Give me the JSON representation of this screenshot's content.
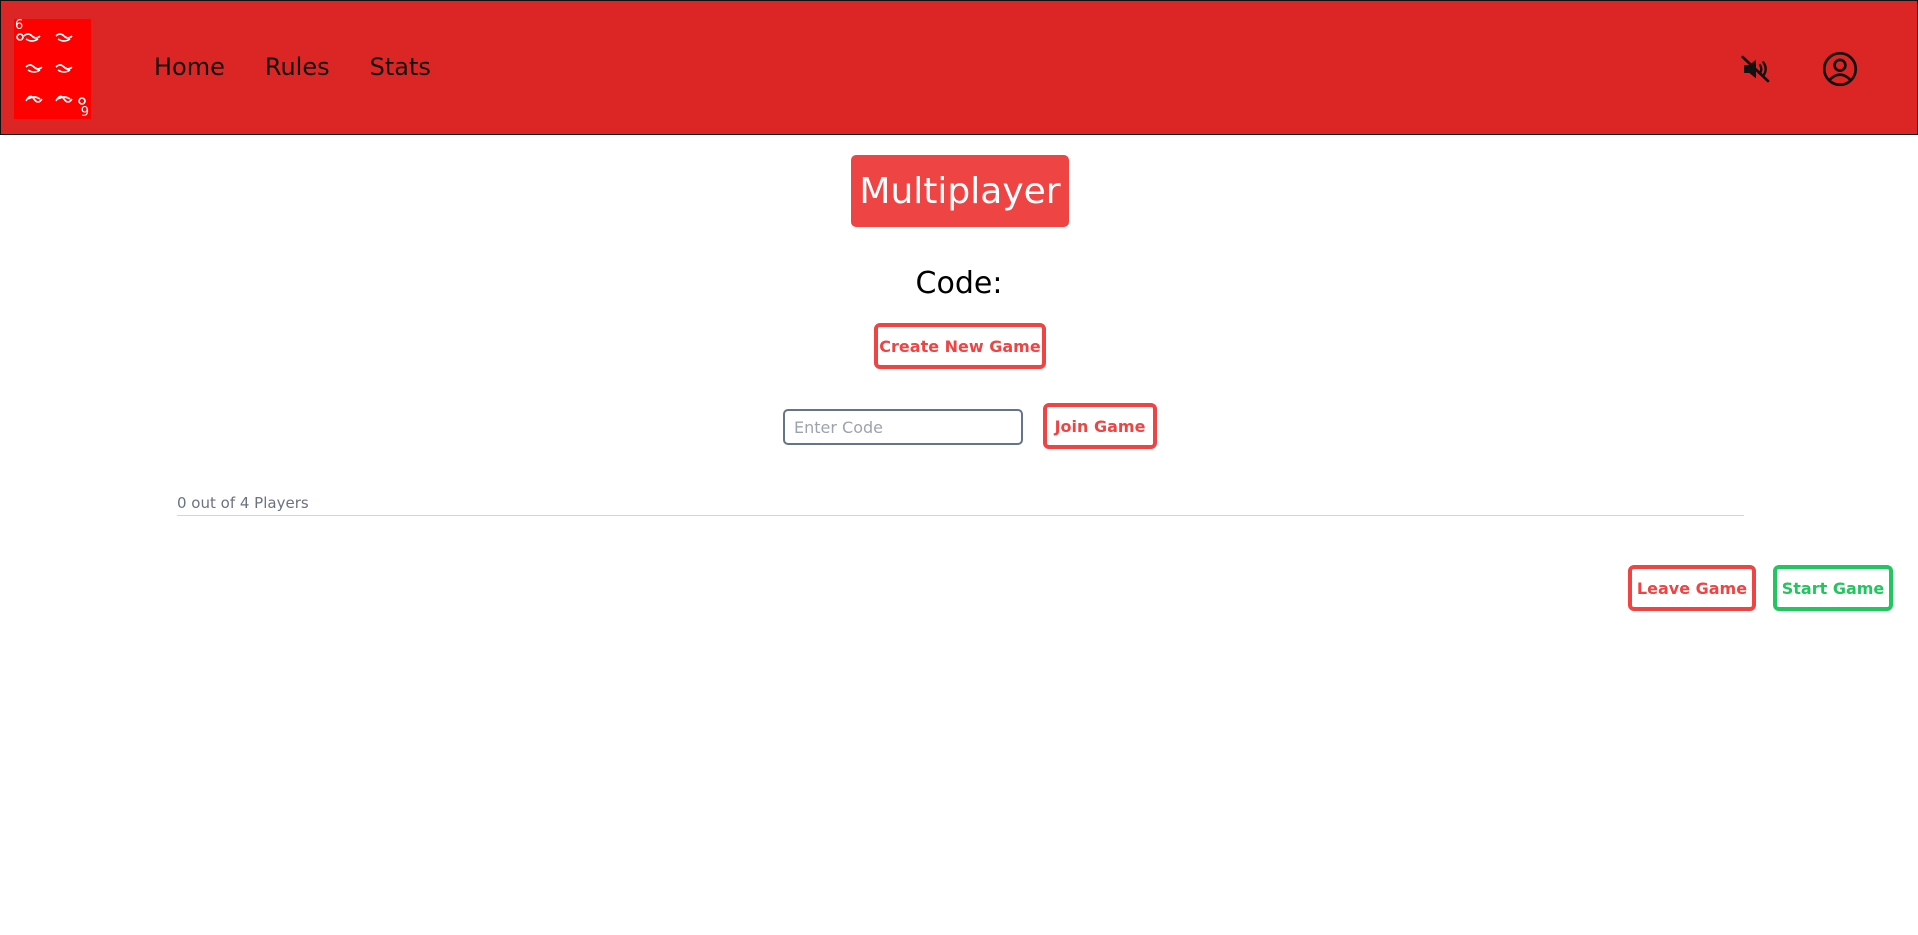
{
  "logo": {
    "icon": "dice-card-logo",
    "corner_top": "6",
    "corner_bottom": "9"
  },
  "nav": {
    "links": [
      {
        "label": "Home"
      },
      {
        "label": "Rules"
      },
      {
        "label": "Stats"
      }
    ],
    "mute_icon": "volume-muted-icon",
    "user_icon": "user-circle-icon"
  },
  "main": {
    "title": "Multiplayer",
    "code_label": "Code:",
    "create_button": "Create New Game",
    "code_input": {
      "value": "",
      "placeholder": "Enter Code"
    },
    "join_button": "Join Game",
    "players_count": "0 out of 4 Players",
    "leave_button": "Leave Game",
    "start_button": "Start Game"
  },
  "colors": {
    "navbar": "#dc2626",
    "accent_red": "#ef4444",
    "accent_green": "#22c55e"
  }
}
